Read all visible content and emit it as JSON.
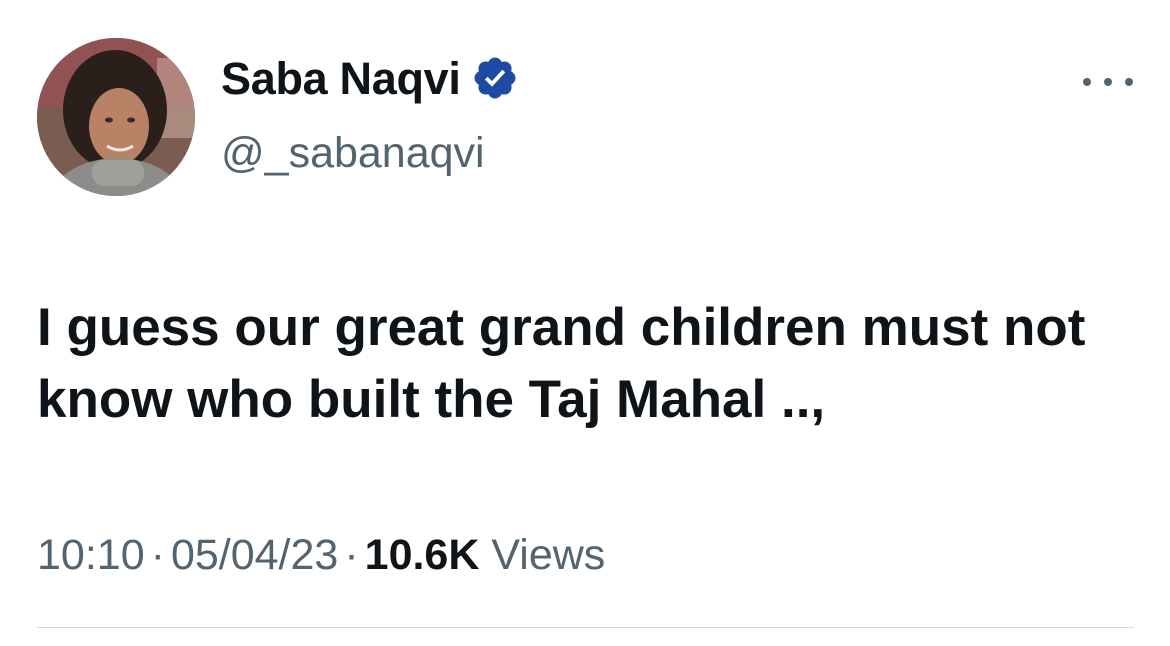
{
  "author": {
    "display_name": "Saba Naqvi",
    "handle": "@_sabanaqvi",
    "verified": true
  },
  "tweet": {
    "text": "I guess our great grand children must not know who built the Taj Mahal ..,"
  },
  "meta": {
    "time": "10:10",
    "separator": "·",
    "date": "05/04/23",
    "views_count": "10.6K",
    "views_label": "Views"
  },
  "icons": {
    "verified": "verified-badge-icon",
    "more": "more-options-icon"
  },
  "colors": {
    "verified_badge": "#1d4ba3",
    "text_primary": "#0f1419",
    "text_secondary": "#536471",
    "divider": "#cfd9de"
  }
}
